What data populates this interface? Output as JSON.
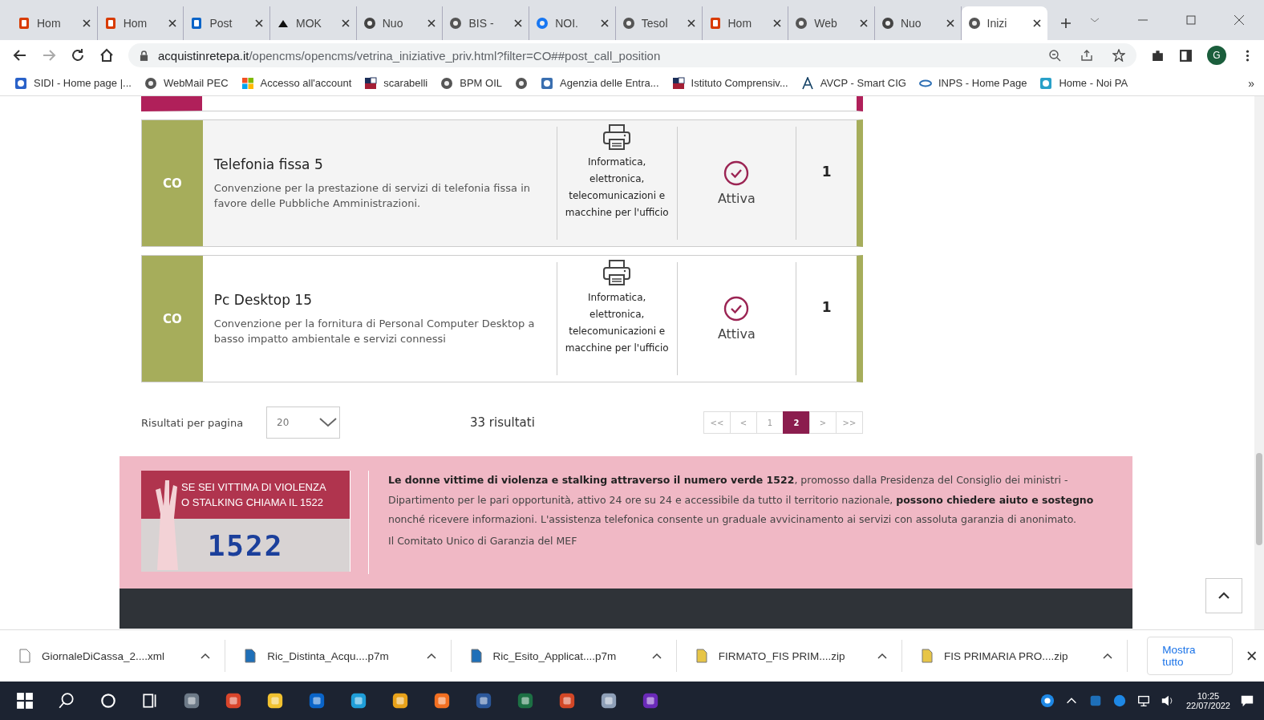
{
  "tabs": [
    {
      "title": "Hom",
      "kind": "office",
      "selected": false
    },
    {
      "title": "Hom",
      "kind": "office",
      "selected": false
    },
    {
      "title": "Post",
      "kind": "outlook",
      "selected": false
    },
    {
      "title": "MOK",
      "kind": "cloud",
      "selected": false
    },
    {
      "title": "Nuo",
      "kind": "chrome",
      "selected": false
    },
    {
      "title": "BIS -",
      "kind": "globe",
      "selected": false
    },
    {
      "title": "NOI.",
      "kind": "facebook",
      "selected": false
    },
    {
      "title": "Tesol",
      "kind": "globe",
      "selected": false
    },
    {
      "title": "Hom",
      "kind": "office",
      "selected": false
    },
    {
      "title": "Web",
      "kind": "globe",
      "selected": false
    },
    {
      "title": "Nuo",
      "kind": "chrome",
      "selected": false
    },
    {
      "title": "Inizi",
      "kind": "globe",
      "selected": true
    }
  ],
  "address": {
    "domain": "acquistinretepa.it",
    "path": "/opencms/opencms/vetrina_iniziative_priv.html?filter=CO##post_call_position"
  },
  "profile": {
    "initial": "G"
  },
  "bookmarks": [
    {
      "label": "SIDI - Home page |...",
      "kind": "sidi"
    },
    {
      "label": "WebMail PEC",
      "kind": "globe"
    },
    {
      "label": "Accesso all'account",
      "kind": "windows"
    },
    {
      "label": "scarabelli",
      "kind": "flag"
    },
    {
      "label": "BPM OIL",
      "kind": "globe"
    },
    {
      "kind": "globe"
    },
    {
      "label": "Agenzia delle Entra...",
      "kind": "agency"
    },
    {
      "label": "Istituto Comprensiv...",
      "kind": "flag"
    },
    {
      "label": "AVCP - Smart CIG",
      "kind": "avcp"
    },
    {
      "label": "INPS - Home Page",
      "kind": "inps"
    },
    {
      "label": "Home - Noi PA",
      "kind": "noipa"
    }
  ],
  "bookmarks_more": "»",
  "rows": [
    {
      "type": "CO",
      "title": "Telefonia fissa 5",
      "description": "Convenzione per la prestazione di servizi di telefonia fissa in favore delle Pubbliche Amministrazioni.",
      "category": "Informatica, elettronica, telecomunicazioni e macchine per l'ufficio",
      "status": "Attiva",
      "count": "1"
    },
    {
      "type": "CO",
      "title": "Pc Desktop 15",
      "description": "Convenzione per la fornitura di Personal Computer Desktop a basso impatto ambientale e servizi connessi",
      "category": "Informatica, elettronica, telecomunicazioni e macchine per l'ufficio",
      "status": "Attiva",
      "count": "1"
    }
  ],
  "results": {
    "per_page_label": "Risultati per pagina",
    "per_page": "20",
    "total": "33 risultati"
  },
  "pagination": [
    {
      "label": "<<",
      "selected": false
    },
    {
      "label": "<",
      "selected": false
    },
    {
      "label": "1",
      "selected": false
    },
    {
      "label": "2",
      "selected": true
    },
    {
      "label": ">",
      "selected": false
    },
    {
      "label": ">>",
      "selected": false
    }
  ],
  "banner": {
    "image_line_1": "SE SEI VITTIMA DI VIOLENZA",
    "image_line_2": "O STALKING CHIAMA IL 1522",
    "image_number": "1522",
    "text": "**Le donne vittime di violenza e stalking attraverso il numero verde 1522**, promosso dalla Presidenza del Consiglio dei ministri - Dipartimento per le pari opportunità, attivo 24 ore su 24 e accessibile da tutto il territorio nazionale, **possono chiedere aiuto e sostegno** nonché ricevere informazioni. L'assistenza telefonica consente un graduale avvicinamento ai servizi con assoluta garanzia di anonimato.",
    "signature": "Il Comitato Unico di Garanzia del MEF"
  },
  "downloads": [
    {
      "name": "GiornaleDiCassa_2....xml",
      "kind": "file"
    },
    {
      "name": "Ric_Distinta_Acqu....p7m",
      "kind": "p7m"
    },
    {
      "name": "Ric_Esito_Applicat....p7m",
      "kind": "p7m"
    },
    {
      "name": "FIRMATO_FIS PRIM....zip",
      "kind": "zip"
    },
    {
      "name": "FIS PRIMARIA PRO....zip",
      "kind": "zip"
    }
  ],
  "show_all": "Mostra tutto",
  "taskbar": {
    "apps": [
      {
        "kind": "calculator"
      },
      {
        "kind": "red"
      },
      {
        "kind": "explorer"
      },
      {
        "kind": "outlook"
      },
      {
        "kind": "edge"
      },
      {
        "kind": "chrome"
      },
      {
        "kind": "firefox"
      },
      {
        "kind": "word"
      },
      {
        "kind": "excel"
      },
      {
        "kind": "powerpoint"
      },
      {
        "kind": "paint"
      },
      {
        "kind": "purple"
      }
    ],
    "time": "10:25",
    "date": "22/07/2022"
  }
}
